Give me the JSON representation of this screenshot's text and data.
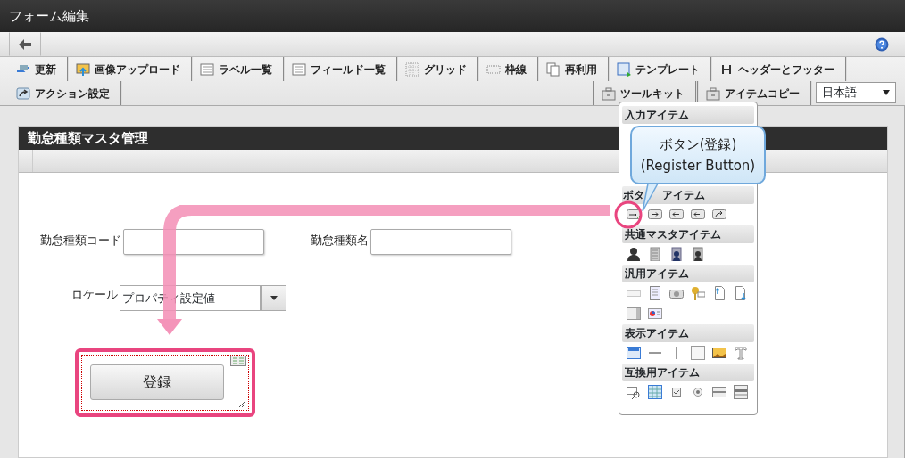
{
  "window": {
    "title": "フォーム編集"
  },
  "toolbar": {
    "main": [
      {
        "label": "更新"
      },
      {
        "label": "画像アップロード"
      },
      {
        "label": "ラベル一覧"
      },
      {
        "label": "フィールド一覧"
      },
      {
        "label": "グリッド"
      },
      {
        "label": "枠線"
      },
      {
        "label": "再利用"
      },
      {
        "label": "テンプレート"
      },
      {
        "label": "ヘッダーとフッター"
      }
    ],
    "secondary": [
      {
        "label": "アクション設定"
      }
    ],
    "right": [
      {
        "label": "ツールキット"
      },
      {
        "label": "アイテムコピー"
      }
    ],
    "language": {
      "value": "日本語"
    }
  },
  "form": {
    "title": "勤怠種類マスタ管理",
    "fields": [
      {
        "label": "勤怠種類コード"
      },
      {
        "label": "勤怠種類名"
      }
    ],
    "locale": {
      "label": "ロケール",
      "value": "プロパティ設定値"
    },
    "button": {
      "label": "登録"
    }
  },
  "toolkit": {
    "sections": [
      {
        "title": "入力アイテム"
      },
      {
        "title_parts": [
          "ボタ",
          "アイテム"
        ]
      },
      {
        "title": "共通マスタアイテム"
      },
      {
        "title": "汎用アイテム"
      },
      {
        "title": "表示アイテム"
      },
      {
        "title": "互換用アイテム"
      }
    ]
  },
  "callout": {
    "lines": [
      "ボタン(登録)",
      "(Register Button)"
    ]
  }
}
